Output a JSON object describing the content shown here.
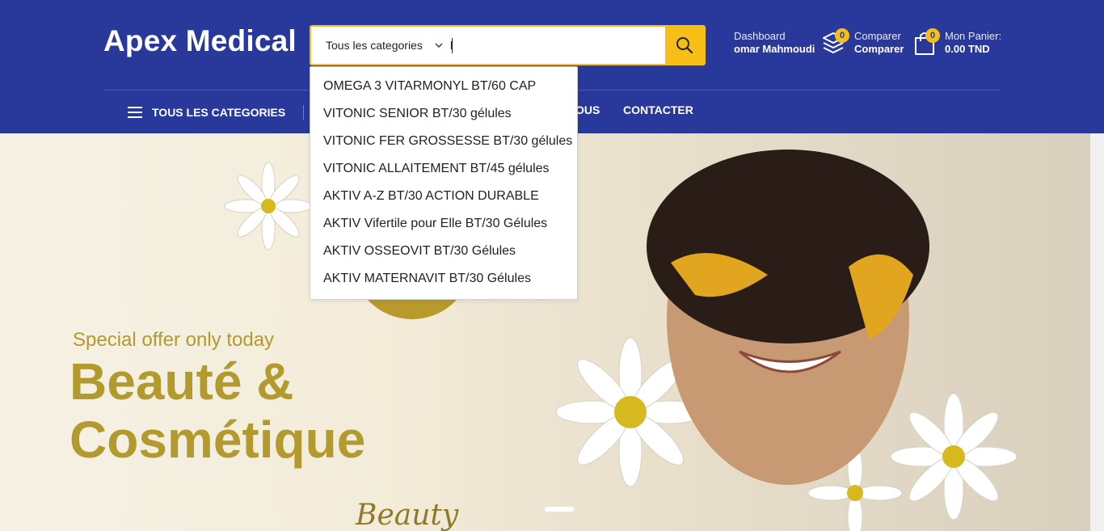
{
  "header": {
    "logo": "Apex Medical",
    "search": {
      "category_label": "Tous les categories",
      "query": "l"
    },
    "account": {
      "label": "Dashboard",
      "name": "omar Mahmoudi"
    },
    "compare": {
      "count": "0",
      "label": "Comparer",
      "value": "Comparer"
    },
    "cart": {
      "count": "0",
      "label": "Mon Panier:",
      "total": "0.00 TND"
    }
  },
  "nav": {
    "categories": "TOUS LES CATEGORIES",
    "hidden_partial": "OUS",
    "contact": "CONTACTER"
  },
  "suggestions": [
    "OMEGA 3 VITARMONYL BT/60 CAP",
    "VITONIC SENIOR BT/30 gélules",
    "VITONIC FER GROSSESSE BT/30 gélules",
    "VITONIC ALLAITEMENT BT/45 gélules",
    "AKTIV A-Z BT/30 ACTION DURABLE",
    "AKTIV Vifertile pour Elle BT/30 Gélules",
    "AKTIV OSSEOVIT BT/30 Gélules",
    "AKTIV MATERNAVIT BT/30 Gélules"
  ],
  "hero": {
    "offer": "Special offer only today",
    "title_line1": "Beauté &",
    "title_line2": "Cosmétique",
    "script": "Beauty"
  },
  "colors": {
    "header_bg": "#28399b",
    "accent": "#f7be16",
    "hero_gold": "#b39a2e"
  },
  "icons": [
    "menu-icon",
    "search-icon",
    "chevron-down-icon",
    "compare-icon",
    "cart-icon"
  ]
}
